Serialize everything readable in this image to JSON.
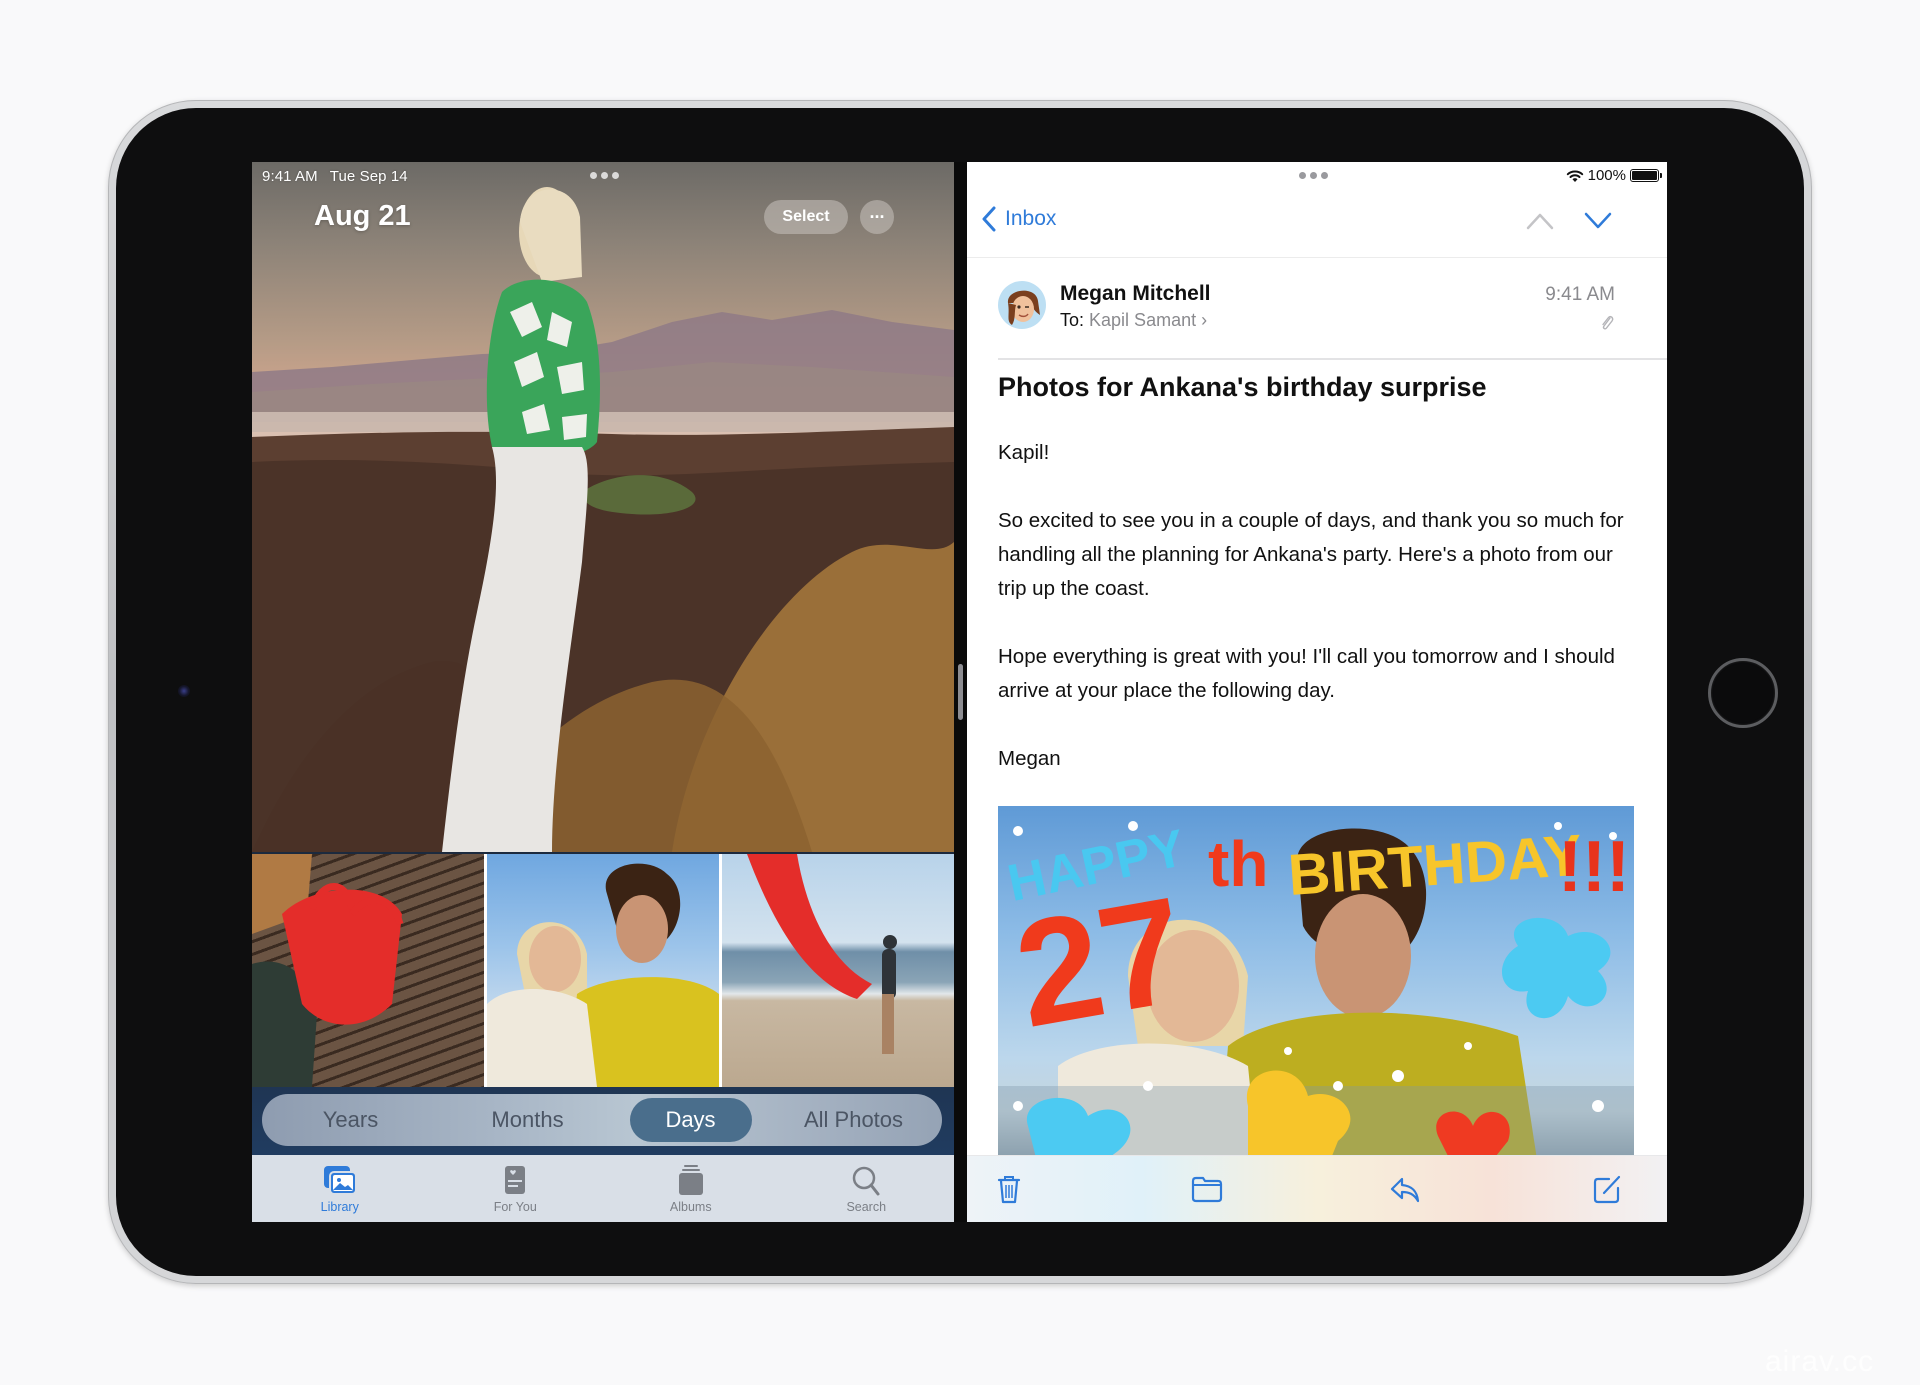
{
  "device": {
    "model": "iPad",
    "watermark": "airav.cc"
  },
  "photos_app": {
    "status_bar": {
      "time": "9:41 AM",
      "date": "Tue Sep 14"
    },
    "header": {
      "title": "Aug 21",
      "select_label": "Select",
      "more_label": "···"
    },
    "hero_photo": {
      "description": "Woman in green checkered sweater overlooking coastline at sunset"
    },
    "thumbnails": [
      {
        "description": "Red tote bag on wooden deck"
      },
      {
        "description": "Two friends smiling selfie"
      },
      {
        "description": "Person holding red fabric on beach"
      }
    ],
    "view_modes": [
      {
        "label": "Years",
        "active": false
      },
      {
        "label": "Months",
        "active": false
      },
      {
        "label": "Days",
        "active": true
      },
      {
        "label": "All Photos",
        "active": false
      }
    ],
    "tabs": [
      {
        "label": "Library",
        "icon": "photo-library-icon",
        "active": true
      },
      {
        "label": "For You",
        "icon": "for-you-icon",
        "active": false
      },
      {
        "label": "Albums",
        "icon": "albums-icon",
        "active": false
      },
      {
        "label": "Search",
        "icon": "search-icon",
        "active": false
      }
    ]
  },
  "mail_app": {
    "status_bar": {
      "battery": "100%",
      "wifi": "full"
    },
    "nav": {
      "back_label": "Inbox"
    },
    "message": {
      "sender": "Megan Mitchell",
      "to_prefix": "To:",
      "recipient": "Kapil Samant",
      "time": "9:41 AM",
      "has_attachment": true,
      "subject": "Photos for Ankana's birthday surprise",
      "greeting": "Kapil!",
      "paragraph1": "So excited to see you in a couple of days, and thank you so much for handling all the planning for Ankana's party. Here's a photo from our trip up the coast.",
      "paragraph2": "Hope everything is great with you! I'll call you tomorrow and I should arrive at your place the following day.",
      "signature": "Megan",
      "attachment_image": {
        "text_happy": "HAPPY",
        "text_number": "27",
        "text_th": "th",
        "text_birthday": "BIRTHDAY",
        "text_exclaim": "!!!"
      }
    },
    "toolbar": [
      {
        "action": "trash",
        "icon": "trash-icon"
      },
      {
        "action": "move",
        "icon": "folder-icon"
      },
      {
        "action": "reply",
        "icon": "reply-icon"
      },
      {
        "action": "compose",
        "icon": "compose-icon"
      }
    ],
    "accent": "#2f7bd9"
  }
}
